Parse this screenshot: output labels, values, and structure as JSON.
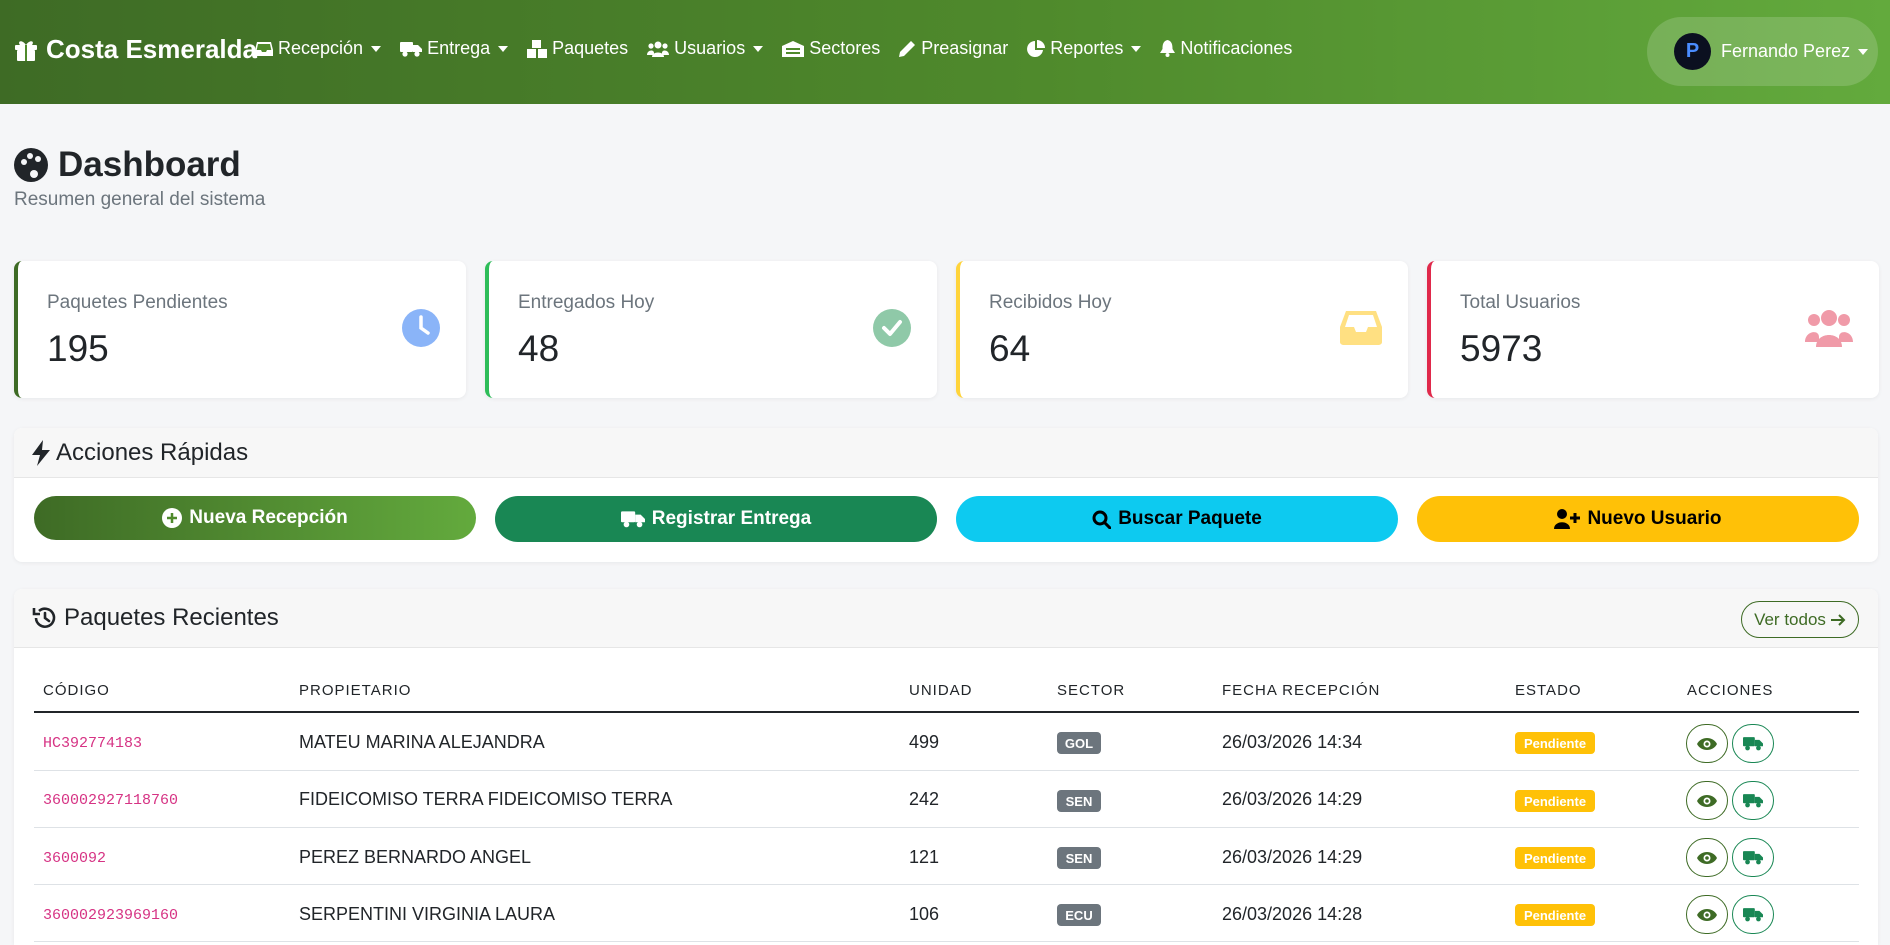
{
  "brand": {
    "name": "Costa Esmeralda"
  },
  "nav": {
    "items": [
      {
        "label": "Recepción",
        "icon": "inbox-icon",
        "dropdown": true
      },
      {
        "label": "Entrega",
        "icon": "truck-icon",
        "dropdown": true
      },
      {
        "label": "Paquetes",
        "icon": "boxes-icon",
        "dropdown": false
      },
      {
        "label": "Usuarios",
        "icon": "users-icon",
        "dropdown": true
      },
      {
        "label": "Sectores",
        "icon": "warehouse-icon",
        "dropdown": false
      },
      {
        "label": "Preasignar",
        "icon": "pencil-icon",
        "dropdown": false
      },
      {
        "label": "Reportes",
        "icon": "pie-chart-icon",
        "dropdown": true
      },
      {
        "label": "Notificaciones",
        "icon": "bell-icon",
        "dropdown": false
      }
    ],
    "user": {
      "name": "Fernando Perez",
      "avatar_letter": "P"
    }
  },
  "header": {
    "title": "Dashboard",
    "subtitle": "Resumen general del sistema"
  },
  "stats": [
    {
      "label": "Paquetes Pendientes",
      "value": "195",
      "icon": "clock-icon",
      "accent": "#3e6b25",
      "icon_color": "#8ab4f8"
    },
    {
      "label": "Entregados Hoy",
      "value": "48",
      "icon": "check-circle-icon",
      "accent": "#2ebd59",
      "icon_color": "#8fc9a8"
    },
    {
      "label": "Recibidos Hoy",
      "value": "64",
      "icon": "inbox-icon",
      "accent": "#ffd43b",
      "icon_color": "#ffe082"
    },
    {
      "label": "Total Usuarios",
      "value": "5973",
      "icon": "users-icon",
      "accent": "#e0294b",
      "icon_color": "#f09aa8"
    }
  ],
  "quick_actions": {
    "title": "Acciones Rápidas",
    "buttons": [
      {
        "label": "Nueva Recepción",
        "icon": "plus-circle-icon",
        "color": "#4f8a2c",
        "text_color": "#ffffff"
      },
      {
        "label": "Registrar Entrega",
        "icon": "truck-icon",
        "color": "#198754",
        "text_color": "#ffffff"
      },
      {
        "label": "Buscar Paquete",
        "icon": "search-icon",
        "color": "#0dcaf0",
        "text_color": "#000000"
      },
      {
        "label": "Nuevo Usuario",
        "icon": "user-plus-icon",
        "color": "#ffc107",
        "text_color": "#000000"
      }
    ]
  },
  "recent": {
    "title": "Paquetes Recientes",
    "view_all": "Ver todos",
    "columns": [
      "CÓDIGO",
      "PROPIETARIO",
      "UNIDAD",
      "SECTOR",
      "FECHA RECEPCIÓN",
      "ESTADO",
      "ACCIONES"
    ],
    "rows": [
      {
        "codigo": "HC392774183",
        "propietario": "MATEU MARINA ALEJANDRA",
        "unidad": "499",
        "sector": "GOL",
        "fecha": "26/03/2026 14:34",
        "estado": "Pendiente"
      },
      {
        "codigo": "360002927118760",
        "propietario": "FIDEICOMISO TERRA FIDEICOMISO TERRA",
        "unidad": "242",
        "sector": "SEN",
        "fecha": "26/03/2026 14:29",
        "estado": "Pendiente"
      },
      {
        "codigo": "3600092",
        "propietario": "PEREZ BERNARDO ANGEL",
        "unidad": "121",
        "sector": "SEN",
        "fecha": "26/03/2026 14:29",
        "estado": "Pendiente"
      },
      {
        "codigo": "360002923969160",
        "propietario": "SERPENTINI VIRGINIA LAURA",
        "unidad": "106",
        "sector": "ECU",
        "fecha": "26/03/2026 14:28",
        "estado": "Pendiente"
      }
    ]
  }
}
